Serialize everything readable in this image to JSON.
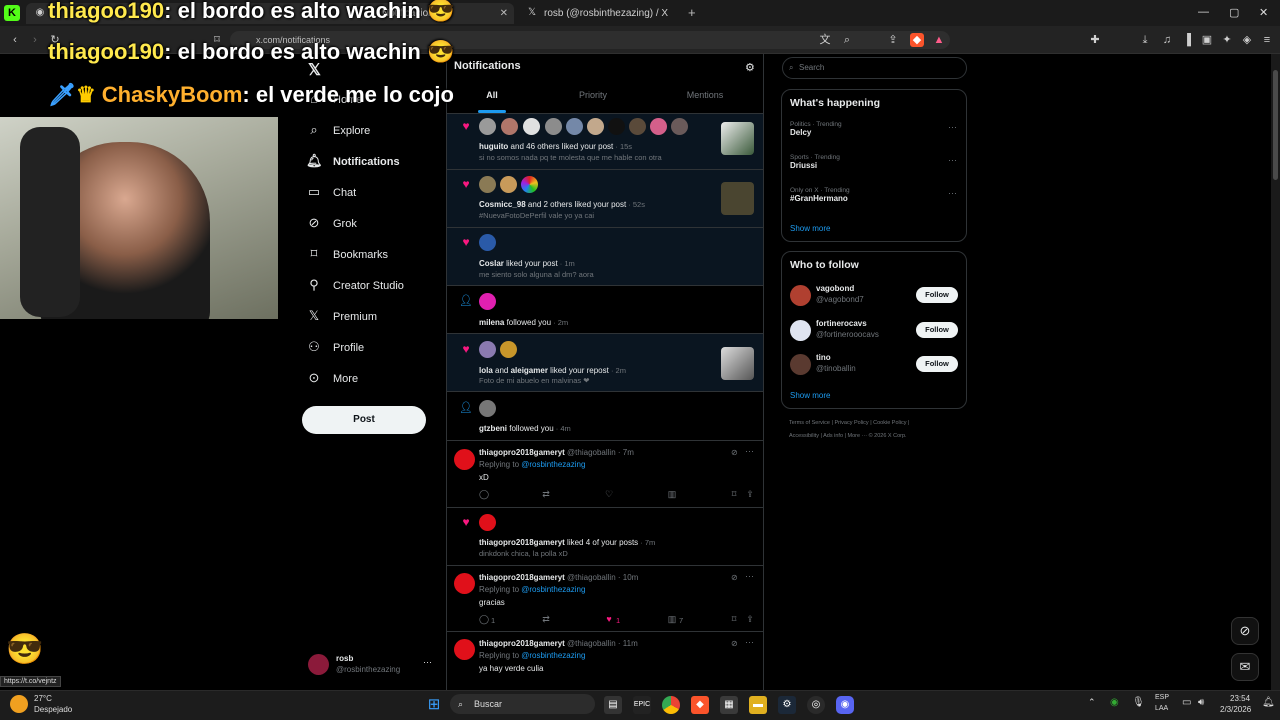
{
  "browser": {
    "tabs": [
      {
        "label": "Notificaciones",
        "icon": "k-icon"
      },
      {
        "label": "rosb (@rosbinthezazing) / X",
        "icon": "x-logo-icon"
      }
    ],
    "new_tab": "+",
    "url": "x.com/notifications",
    "status_url": "https://t.co/vejntz"
  },
  "chat_overlay": {
    "messages": [
      {
        "user": "thiagoo190",
        "text": ": el bordo es alto wachin",
        "user_color": "#ffe94d"
      },
      {
        "user": "thiagoo190",
        "text": ": el bordo es alto wachin",
        "user_color": "#ffe94d"
      },
      {
        "user": "ChaskyBoom",
        "text": ": el verde me lo cojo",
        "user_color": "#ffb02e"
      }
    ]
  },
  "sidebar": {
    "items": [
      {
        "label": "Home",
        "icon": "home-icon"
      },
      {
        "label": "Explore",
        "icon": "search-icon"
      },
      {
        "label": "Notifications",
        "icon": "bell-icon",
        "active": true
      },
      {
        "label": "Chat",
        "icon": "chat-icon"
      },
      {
        "label": "Grok",
        "icon": "grok-icon"
      },
      {
        "label": "Bookmarks",
        "icon": "bookmark-icon"
      },
      {
        "label": "Creator Studio",
        "icon": "studio-icon"
      },
      {
        "label": "Premium",
        "icon": "x-logo-icon"
      },
      {
        "label": "Profile",
        "icon": "person-icon"
      },
      {
        "label": "More",
        "icon": "more-icon"
      }
    ],
    "post_label": "Post",
    "account": {
      "name": "rosb",
      "handle": "@rosbinthezazing"
    }
  },
  "notifications": {
    "title": "Notifications",
    "tabs": [
      "All",
      "Priority",
      "Mentions"
    ],
    "active_tab": "All",
    "items": [
      {
        "type": "like",
        "actor": "huguito",
        "rest": " and 46 others liked your post",
        "time": "15s",
        "sub": "si no somos nada pq te molesta que me hable con otra"
      },
      {
        "type": "like",
        "actor": "Cosmicc_98",
        "rest": " and 2 others liked your post",
        "time": "52s",
        "sub": "#NuevaFotoDePerfil vale yo ya cai"
      },
      {
        "type": "like",
        "actor": "Coslar",
        "rest": " liked your post",
        "time": "1m",
        "sub": "me siento solo alguna al dm? aora"
      },
      {
        "type": "follow",
        "actor": "milena",
        "rest": " followed you",
        "time": "2m"
      },
      {
        "type": "like",
        "actor": "lola",
        "mid": " and ",
        "actor2": "aleigamer",
        "rest": " liked your repost",
        "time": "2m",
        "sub": "Foto de mi abuelo en malvinas ❤"
      },
      {
        "type": "follow",
        "actor": "gtzbeni",
        "rest": " followed you",
        "time": "4m"
      }
    ],
    "posts": [
      {
        "name": "thiagopro2018gameryt",
        "handle": "@thiagoballin",
        "time": "7m",
        "replying_prefix": "Replying to ",
        "replying_to": "@rosbinthezazing",
        "body": "xD"
      },
      {
        "name": "thiagopro2018gameryt",
        "handle": "@thiagoballin",
        "time": "10m",
        "replying_prefix": "Replying to ",
        "replying_to": "@rosbinthezazing",
        "body": "gracias",
        "reply_count": "1",
        "like_count": "1",
        "views": "7"
      },
      {
        "name": "thiagopro2018gameryt",
        "handle": "@thiagoballin",
        "time": "11m",
        "replying_prefix": "Replying to ",
        "replying_to": "@rosbinthezazing",
        "body": "ya hay verde culia"
      }
    ],
    "like_many": {
      "actor": "thiagopro2018gameryt",
      "rest": " liked 4 of your posts",
      "time": "7m",
      "sub": "dinkdonk chica, la polla xD"
    }
  },
  "right": {
    "search_placeholder": "Search",
    "happening_title": "What's happening",
    "trends": [
      {
        "meta": "Politics · Trending",
        "name": "Delcy"
      },
      {
        "meta": "Sports · Trending",
        "name": "Driussi"
      },
      {
        "meta": "Only on X · Trending",
        "name": "#GranHermano"
      }
    ],
    "show_more": "Show more",
    "follow_title": "Who to follow",
    "follow": [
      {
        "name": "vagobond",
        "handle": "@vagobond7"
      },
      {
        "name": "fortinerocavs",
        "handle": "@fortinerooocavs"
      },
      {
        "name": "tino",
        "handle": "@tinoballin"
      }
    ],
    "follow_label": "Follow",
    "footer1": "Terms of Service  |  Privacy Policy  |  Cookie Policy  |",
    "footer2": "Accessibility  |  Ads info  |  More ···  © 2026 X Corp."
  },
  "taskbar": {
    "weather_temp": "27°C",
    "weather_text": "Despejado",
    "search_label": "Buscar",
    "lang1": "ESP",
    "lang2": "LAA",
    "time": "23:54",
    "date": "2/3/2026"
  },
  "colors": {
    "accent": "#1d9bf0",
    "like": "#f91880",
    "bg": "#000000"
  }
}
